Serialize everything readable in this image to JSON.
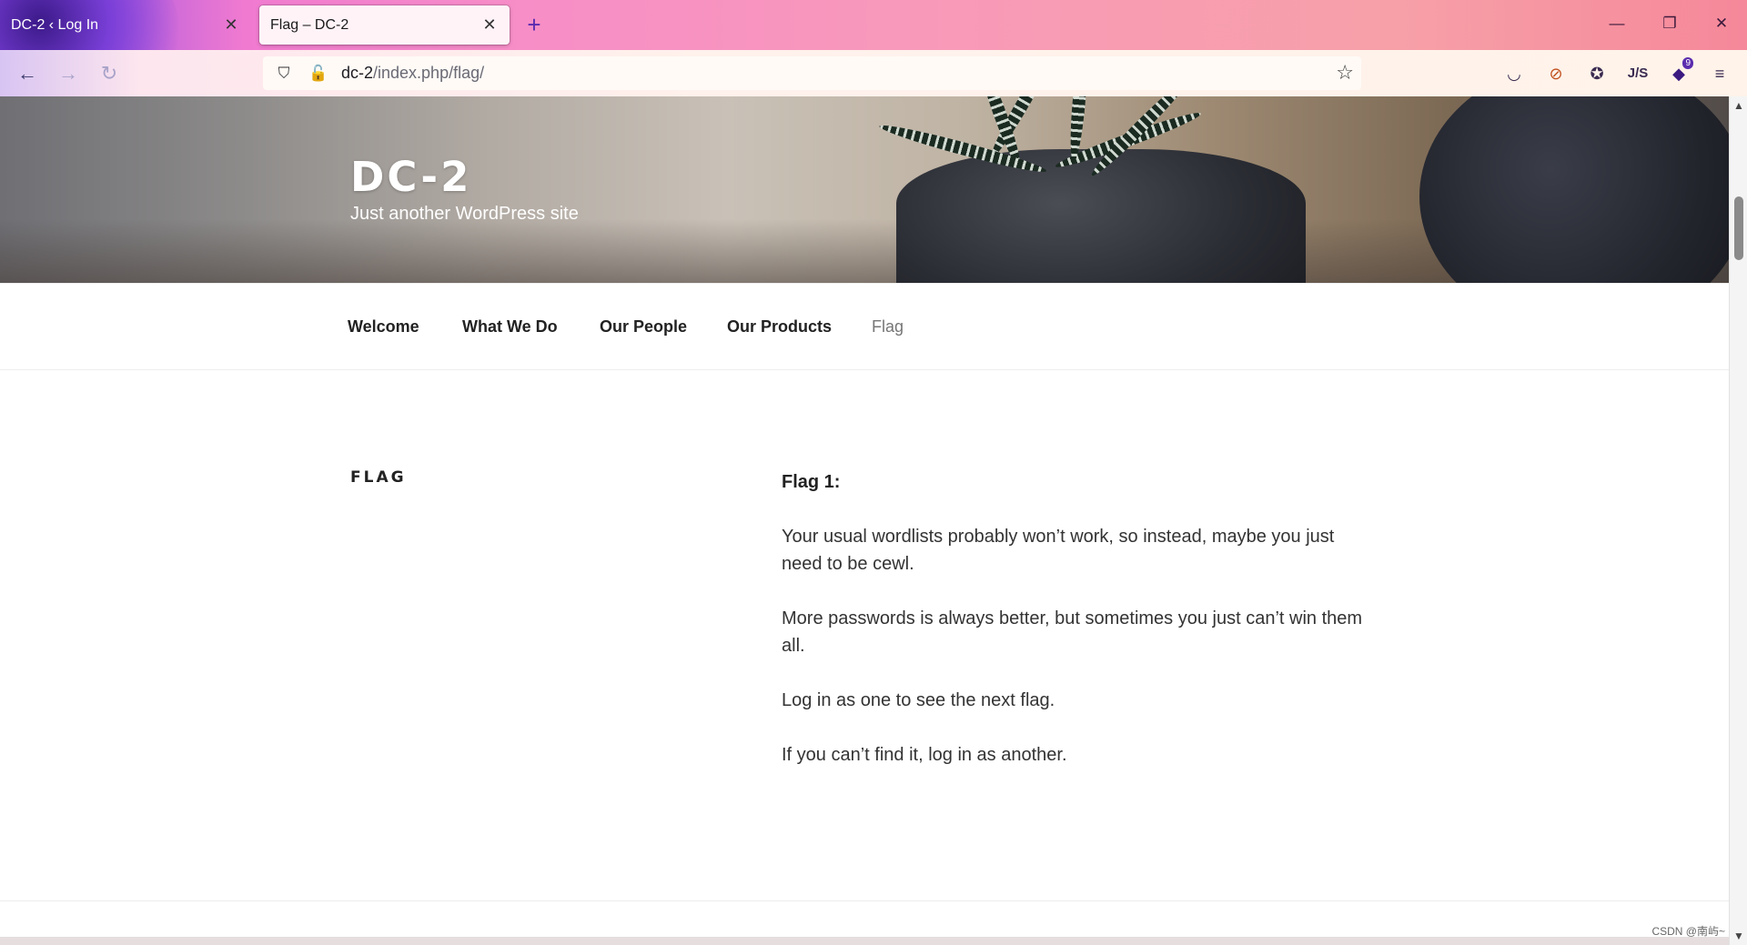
{
  "browser": {
    "tabs": [
      {
        "title": "DC-2 ‹ Log In",
        "active": false
      },
      {
        "title": "Flag – DC-2",
        "active": true
      }
    ],
    "new_tab_icon": "plus-icon",
    "url": {
      "host": "dc-2",
      "path": "/index.php/flag/"
    },
    "window_controls": {
      "minimize": "—",
      "restore": "❐",
      "close": "✕"
    }
  },
  "site": {
    "title": "DC-2",
    "description": "Just another WordPress site"
  },
  "menu": {
    "items": [
      {
        "label": "Welcome",
        "current": false
      },
      {
        "label": "What We Do",
        "current": false
      },
      {
        "label": "Our People",
        "current": false
      },
      {
        "label": "Our Products",
        "current": false
      },
      {
        "label": "Flag",
        "current": true
      }
    ]
  },
  "page": {
    "title": "FLAG",
    "heading": "Flag 1:",
    "paragraphs": [
      "Your usual wordlists probably won’t work, so instead, maybe you just need to be cewl.",
      "More passwords is always better, but sometimes you just can’t win them all.",
      "Log in as one to see the next flag.",
      "If you can’t find it, log in as another."
    ]
  },
  "watermark": "CSDN @南屿~"
}
